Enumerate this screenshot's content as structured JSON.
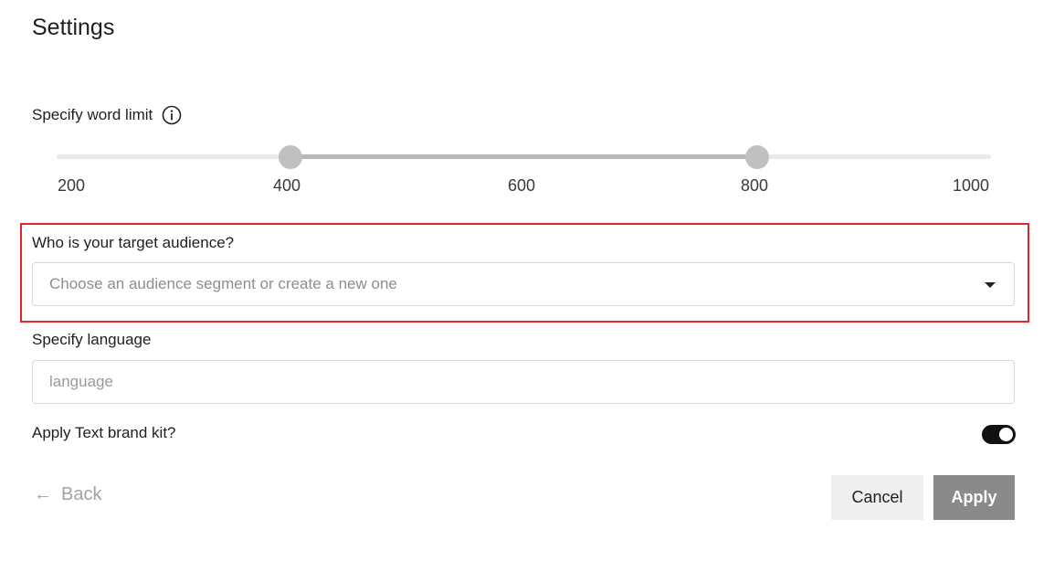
{
  "title": "Settings",
  "word_limit": {
    "label": "Specify word limit",
    "min": 200,
    "max": 1000,
    "selected_low": 400,
    "selected_high": 800,
    "ticks": [
      "200",
      "400",
      "600",
      "800",
      "1000"
    ]
  },
  "audience": {
    "label": "Who is your target audience?",
    "placeholder": "Choose an audience segment or create a new one"
  },
  "language": {
    "label": "Specify language",
    "placeholder": "language"
  },
  "brand_kit": {
    "label": "Apply Text brand kit?",
    "enabled": true
  },
  "footer": {
    "back_label": "Back",
    "cancel_label": "Cancel",
    "apply_label": "Apply"
  },
  "colors": {
    "highlight_border": "#e2262d",
    "apply_button_bg": "#8a8a8a",
    "toggle_on": "#111111"
  }
}
